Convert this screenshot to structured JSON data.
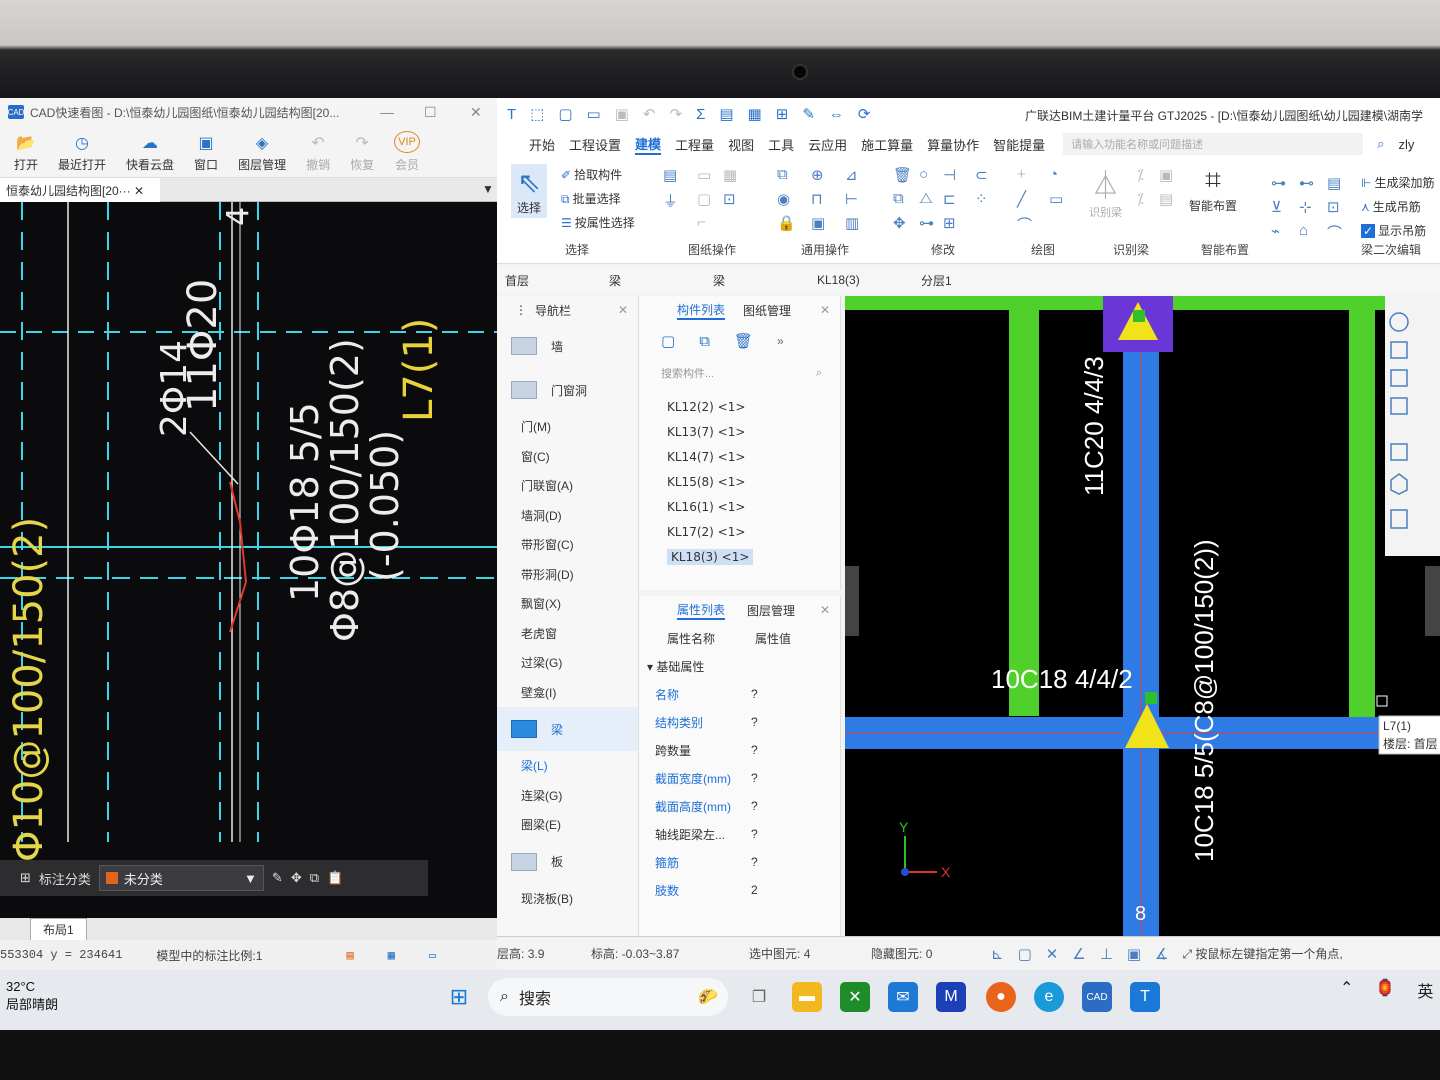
{
  "cad": {
    "title": "CAD快速看图 - D:\\恒泰幼儿园图纸\\恒泰幼儿园结构图[20...",
    "toolbar": [
      {
        "label": "打开",
        "icon": "folder-open-icon"
      },
      {
        "label": "最近打开",
        "icon": "clock-icon"
      },
      {
        "label": "快看云盘",
        "icon": "cloud-icon"
      },
      {
        "label": "窗口",
        "icon": "window-icon"
      },
      {
        "label": "图层管理",
        "icon": "layers-icon"
      },
      {
        "label": "撤销",
        "icon": "undo-icon"
      },
      {
        "label": "恢复",
        "icon": "redo-icon"
      },
      {
        "label": "会员",
        "icon": "vip-icon"
      }
    ],
    "doc_tab": "恒泰幼儿园结构图[20···",
    "drawing_texts": {
      "a": "11Φ20",
      "b": "2Φ14",
      "c": "10Φ18 5/5",
      "d": "Φ8@100/150(2)",
      "e": "(-0.050)",
      "f": "L7(1)",
      "g": "Φ10@100/150(2)",
      "h": "4"
    },
    "annot_label": "标注分类",
    "annot_value": "未分类",
    "layout_tab": "布局1",
    "status_coord": "553304 y = 234641",
    "status_scale": "模型中的标注比例:1"
  },
  "gtj": {
    "title": "广联达BIM土建计量平台 GTJ2025 - [D:\\恒泰幼儿园图纸\\幼儿园建模\\湖南学",
    "menu": [
      "开始",
      "工程设置",
      "建模",
      "工程量",
      "视图",
      "工具",
      "云应用",
      "施工算量",
      "算量协作",
      "智能提量"
    ],
    "search_placeholder": "请输入功能名称或问题描述",
    "user": "zly",
    "ribbon": {
      "select": "选择",
      "pick": "拾取构件",
      "batch": "批量选择",
      "by_attr": "按属性选择",
      "grp_select": "选择",
      "grp_drawing": "图纸操作",
      "grp_common": "通用操作",
      "grp_modify": "修改",
      "grp_draw": "绘图",
      "identify_beam": "识别梁",
      "grp_identify": "识别梁",
      "smart_layout": "智能布置",
      "grp_smart": "智能布置",
      "gen_beam_add": "生成梁加筋",
      "gen_hanger": "生成吊筋",
      "show_hanger": "显示吊筋",
      "grp_second": "梁二次编辑"
    },
    "filter": [
      "首层",
      "梁",
      "梁",
      "KL18(3)",
      "分层1"
    ],
    "nav": {
      "title": "导航栏",
      "items": [
        {
          "kind": "cat",
          "label": "墙"
        },
        {
          "kind": "cat",
          "label": "门窗洞"
        },
        {
          "kind": "item",
          "label": "门(M)"
        },
        {
          "kind": "item",
          "label": "窗(C)"
        },
        {
          "kind": "item",
          "label": "门联窗(A)"
        },
        {
          "kind": "item",
          "label": "墙洞(D)"
        },
        {
          "kind": "item",
          "label": "带形窗(C)"
        },
        {
          "kind": "item",
          "label": "带形洞(D)"
        },
        {
          "kind": "item",
          "label": "飘窗(X)"
        },
        {
          "kind": "item",
          "label": "老虎窗"
        },
        {
          "kind": "item",
          "label": "过梁(G)"
        },
        {
          "kind": "item",
          "label": "壁龛(I)"
        },
        {
          "kind": "cat",
          "label": "梁",
          "selected": true
        },
        {
          "kind": "item",
          "label": "梁(L)",
          "selected": true
        },
        {
          "kind": "item",
          "label": "连梁(G)"
        },
        {
          "kind": "item",
          "label": "圈梁(E)"
        },
        {
          "kind": "cat",
          "label": "板"
        },
        {
          "kind": "item",
          "label": "现浇板(B)"
        }
      ]
    },
    "comp_tabs": [
      "构件列表",
      "图纸管理"
    ],
    "comp_search": "搜索构件...",
    "components": [
      "KL12(2) <1>",
      "KL13(7) <1>",
      "KL14(7) <1>",
      "KL15(8) <1>",
      "KL16(1) <1>",
      "KL17(2) <1>",
      "KL18(3) <1>"
    ],
    "prop_tabs": [
      "属性列表",
      "图层管理"
    ],
    "prop_header": {
      "name": "属性名称",
      "value": "属性值"
    },
    "prop_group": "基础属性",
    "props": [
      {
        "name": "名称",
        "value": "?",
        "blue": true
      },
      {
        "name": "结构类别",
        "value": "?",
        "blue": true
      },
      {
        "name": "跨数量",
        "value": "?",
        "blue": false
      },
      {
        "name": "截面宽度(mm)",
        "value": "?",
        "blue": true
      },
      {
        "name": "截面高度(mm)",
        "value": "?",
        "blue": true
      },
      {
        "name": "轴线距梁左...",
        "value": "?",
        "blue": false
      },
      {
        "name": "箍筋",
        "value": "?",
        "blue": true
      },
      {
        "name": "肢数",
        "value": "2",
        "blue": true
      }
    ],
    "canvas": {
      "t1": "11C20 4/4/3",
      "t2": "10C18 4/4/2",
      "t3": "10C18 5/5(C8@100/150(2))",
      "t4": "8",
      "tip1": "L7(1)",
      "tip2": "楼层: 首层",
      "axis_x": "X",
      "axis_y": "Y"
    },
    "status": {
      "floor_h_label": "层高:",
      "floor_h": "3.9",
      "elev_label": "标高:",
      "elev": "-0.03~3.87",
      "sel_label": "选中图元:",
      "sel": "4",
      "hidden_label": "隐藏图元:",
      "hidden": "0",
      "hint": "按鼠标左键指定第一个角点,"
    }
  },
  "taskbar": {
    "temp": "32°C",
    "weather": "局部晴朗",
    "search": "搜索",
    "ime": "英"
  },
  "colors": {
    "beam_blue": "#2f7be6",
    "beam_green": "#4fd02a",
    "cad_cyan": "#3ed6e6",
    "accent": "#1f6fd6"
  }
}
